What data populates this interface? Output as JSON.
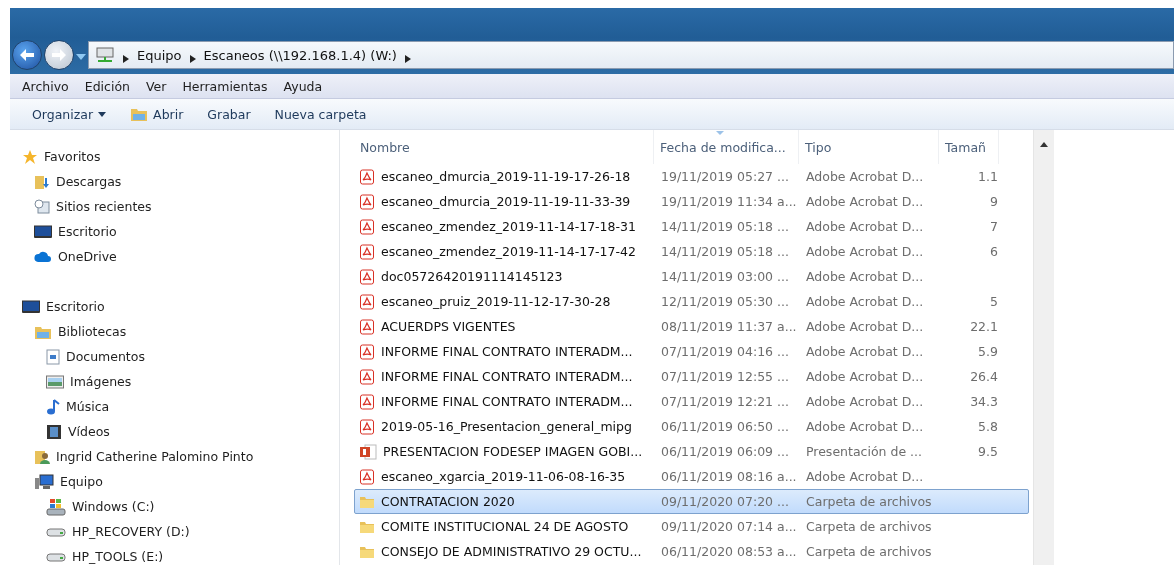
{
  "address_bar": {
    "crumbs": [
      "Equipo",
      "Escaneos (\\\\192.168.1.4) (W:)"
    ]
  },
  "menu_bar": [
    "Archivo",
    "Edición",
    "Ver",
    "Herramientas",
    "Ayuda"
  ],
  "toolbar": [
    {
      "label": "Organizar",
      "kind": "dropdown"
    },
    {
      "label": "Abrir",
      "kind": "icon"
    },
    {
      "label": "Grabar",
      "kind": "plain"
    },
    {
      "label": "Nueva carpeta",
      "kind": "plain"
    }
  ],
  "sidebar": {
    "groups": [
      {
        "label": "Favoritos",
        "kind": "star",
        "children": [
          {
            "label": "Descargas",
            "kind": "download"
          },
          {
            "label": "Sitios recientes",
            "kind": "recent"
          },
          {
            "label": "Escritorio",
            "kind": "desktop"
          },
          {
            "label": "OneDrive",
            "kind": "cloud"
          }
        ]
      },
      {
        "label": "Escritorio",
        "kind": "desktop",
        "children": [
          {
            "label": "Bibliotecas",
            "kind": "library",
            "children": [
              {
                "label": "Documentos",
                "kind": "document"
              },
              {
                "label": "Imágenes",
                "kind": "picture"
              },
              {
                "label": "Música",
                "kind": "music"
              },
              {
                "label": "Vídeos",
                "kind": "video"
              }
            ]
          },
          {
            "label": "Ingrid Catherine Palomino Pinto",
            "kind": "user"
          },
          {
            "label": "Equipo",
            "kind": "computer",
            "children": [
              {
                "label": "Windows  (C:)",
                "kind": "windrive"
              },
              {
                "label": "HP_RECOVERY (D:)",
                "kind": "drive"
              },
              {
                "label": "HP_TOOLS (E:)",
                "kind": "drive"
              }
            ]
          }
        ]
      }
    ]
  },
  "table": {
    "columns": [
      "Nombre",
      "Fecha de modifica...",
      "Tipo",
      "Tamañ"
    ],
    "rows": [
      {
        "kind": "pdf",
        "name": "escaneo_dmurcia_2019-11-19-17-26-18",
        "date": "19/11/2019 05:27 ...",
        "type": "Adobe Acrobat D...",
        "size": "1.1",
        "selected": false
      },
      {
        "kind": "pdf",
        "name": "escaneo_dmurcia_2019-11-19-11-33-39",
        "date": "19/11/2019 11:34 a...",
        "type": "Adobe Acrobat D...",
        "size": "9",
        "selected": false
      },
      {
        "kind": "pdf",
        "name": "escaneo_zmendez_2019-11-14-17-18-31",
        "date": "14/11/2019 05:18 ...",
        "type": "Adobe Acrobat D...",
        "size": "7",
        "selected": false
      },
      {
        "kind": "pdf",
        "name": "escaneo_zmendez_2019-11-14-17-17-42",
        "date": "14/11/2019 05:18 ...",
        "type": "Adobe Acrobat D...",
        "size": "6",
        "selected": false
      },
      {
        "kind": "pdf",
        "name": "doc05726420191114145123",
        "date": "14/11/2019 03:00 ...",
        "type": "Adobe Acrobat D...",
        "selected": false
      },
      {
        "kind": "pdf",
        "name": "escaneo_pruiz_2019-11-12-17-30-28",
        "date": "12/11/2019 05:30 ...",
        "type": "Adobe Acrobat D...",
        "size": "5",
        "selected": false
      },
      {
        "kind": "pdf",
        "name": "ACUERDPS VIGENTES",
        "date": "08/11/2019 11:37 a...",
        "type": "Adobe Acrobat D...",
        "size": "22.1",
        "selected": false
      },
      {
        "kind": "pdf",
        "name": "INFORME FINAL CONTRATO INTERADM...",
        "date": "07/11/2019 04:16 ...",
        "type": "Adobe Acrobat D...",
        "size": "5.9",
        "selected": false
      },
      {
        "kind": "pdf",
        "name": "INFORME FINAL CONTRATO INTERADM...",
        "date": "07/11/2019 12:55 ...",
        "type": "Adobe Acrobat D...",
        "size": "26.4",
        "selected": false
      },
      {
        "kind": "pdf",
        "name": "INFORME FINAL CONTRATO INTERADM...",
        "date": "07/11/2019 12:21 ...",
        "type": "Adobe Acrobat D...",
        "size": "34.3",
        "selected": false
      },
      {
        "kind": "pdf",
        "name": "2019-05-16_Presentacion_general_mipg",
        "date": "06/11/2019 06:50 ...",
        "type": "Adobe Acrobat D...",
        "size": "5.8",
        "selected": false
      },
      {
        "kind": "pptx",
        "name": "PRESENTACION FODESEP IMAGEN GOBI...",
        "date": "06/11/2019 06:09 ...",
        "type": "Presentación de ...",
        "size": "9.5",
        "selected": false
      },
      {
        "kind": "pdf",
        "name": "escaneo_xgarcia_2019-11-06-08-16-35",
        "date": "06/11/2019 08:16 a...",
        "type": "Adobe Acrobat D...",
        "selected": false
      },
      {
        "kind": "folder",
        "name": "CONTRATACION 2020",
        "date": "09/11/2020 07:20 ...",
        "type": "Carpeta de archivos",
        "selected": true
      },
      {
        "kind": "folder",
        "name": "COMITE INSTITUCIONAL 24  DE AGOSTO",
        "date": "09/11/2020 07:14 a...",
        "type": "Carpeta de archivos",
        "selected": false
      },
      {
        "kind": "folder",
        "name": "CONSEJO DE ADMINISTRATIVO 29 OCTU...",
        "date": "06/11/2020 08:53 a...",
        "type": "Carpeta de archivos",
        "selected": false
      }
    ]
  }
}
